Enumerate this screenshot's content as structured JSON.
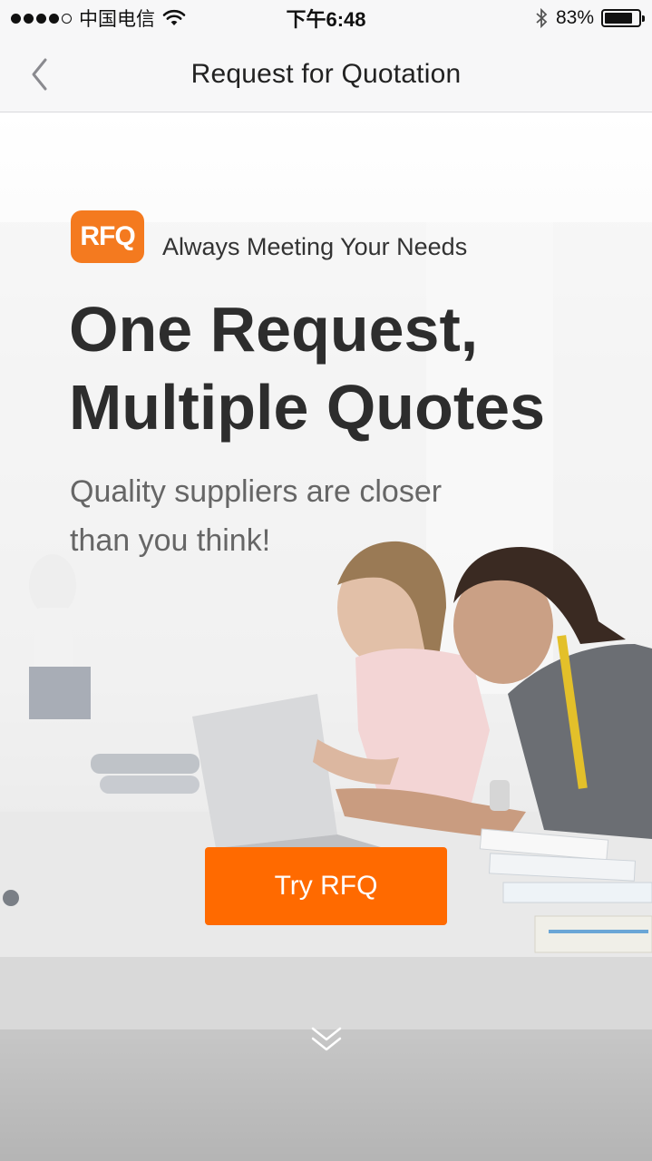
{
  "status_bar": {
    "carrier": "中国电信",
    "time": "下午6:48",
    "battery": "83%",
    "battery_level": 0.83,
    "icons": [
      "signal-dots",
      "wifi-icon",
      "bluetooth-icon",
      "battery-icon"
    ]
  },
  "nav": {
    "title": "Request for Quotation",
    "back_icon": "chevron-left-icon"
  },
  "hero": {
    "logo_text": "RFQ",
    "tagline": "Always Meeting Your Needs",
    "headline_line1": "One Request,",
    "headline_line2": "Multiple Quotes",
    "subline": "Quality suppliers are closer than you think!",
    "cta_label": "Try RFQ",
    "scroll_icon": "double-chevron-down-icon"
  },
  "colors": {
    "accent": "#ff6a00",
    "logo": "#f47a1f",
    "headline": "#2d2d2d",
    "subline": "#666666",
    "bar_bg": "#f7f7f8"
  }
}
